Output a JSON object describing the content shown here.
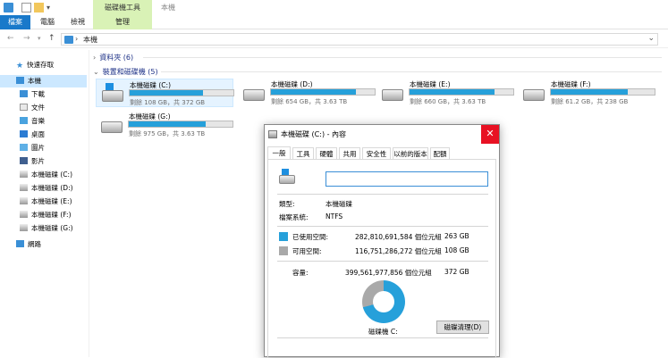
{
  "window": {
    "title": "本機",
    "context_tab": "磁碟機工具"
  },
  "ribbon": {
    "tabs": [
      {
        "label": "檔案"
      },
      {
        "label": "電腦"
      },
      {
        "label": "檢視"
      },
      {
        "label": "管理"
      }
    ]
  },
  "address": {
    "crumb": "本機"
  },
  "nav": {
    "items": [
      {
        "label": "快速存取",
        "icon": "star-icon"
      },
      {
        "label": "本機",
        "icon": "computer-icon",
        "selected": true
      },
      {
        "label": "下載",
        "icon": "download-icon"
      },
      {
        "label": "文件",
        "icon": "document-icon"
      },
      {
        "label": "音樂",
        "icon": "music-icon"
      },
      {
        "label": "桌面",
        "icon": "desktop-icon"
      },
      {
        "label": "圖片",
        "icon": "picture-icon"
      },
      {
        "label": "影片",
        "icon": "video-icon"
      },
      {
        "label": "本機磁碟 (C:)",
        "icon": "drive-icon"
      },
      {
        "label": "本機磁碟 (D:)",
        "icon": "drive-icon"
      },
      {
        "label": "本機磁碟 (E:)",
        "icon": "drive-icon"
      },
      {
        "label": "本機磁碟 (F:)",
        "icon": "drive-icon"
      },
      {
        "label": "本機磁碟 (G:)",
        "icon": "drive-icon"
      },
      {
        "label": "網路",
        "icon": "network-icon"
      }
    ]
  },
  "main": {
    "folders_group": "資料夾 (6)",
    "drives_group": "裝置和磁碟機 (5)",
    "drives": [
      {
        "name": "本機磁碟 (C:)",
        "free": "剩餘 108 GB，共 372 GB",
        "used_fraction": 0.71
      },
      {
        "name": "本機磁碟 (D:)",
        "free": "剩餘 654 GB，共 3.63 TB",
        "used_fraction": 0.82
      },
      {
        "name": "本機磁碟 (E:)",
        "free": "剩餘 660 GB，共 3.63 TB",
        "used_fraction": 0.82
      },
      {
        "name": "本機磁碟 (F:)",
        "free": "剩餘 61.2 GB，共 238 GB",
        "used_fraction": 0.74
      },
      {
        "name": "本機磁碟 (G:)",
        "free": "剩餘 975 GB，共 3.63 TB",
        "used_fraction": 0.74
      }
    ]
  },
  "dialog": {
    "title": "本機磁碟 (C:) - 內容",
    "close": "✕",
    "tabs": [
      "一般",
      "工具",
      "硬體",
      "共用",
      "安全性",
      "以前的版本",
      "配額"
    ],
    "name_value": "",
    "type_label": "類型:",
    "type_value": "本機磁碟",
    "fs_label": "檔案系統:",
    "fs_value": "NTFS",
    "used_label": "已使用空間:",
    "used_bytes": "282,810,691,584 個位元組",
    "used_gb": "263 GB",
    "free_label": "可用空間:",
    "free_bytes": "116,751,286,272 個位元組",
    "free_gb": "108 GB",
    "capacity_label": "容量:",
    "capacity_bytes": "399,561,977,856 個位元組",
    "capacity_gb": "372 GB",
    "drive_label": "磁碟機 C:",
    "cleanup_button": "磁碟清理(D)",
    "used_fraction": 0.708,
    "used_color": "#26a0da",
    "free_color": "#a9a9a9"
  }
}
